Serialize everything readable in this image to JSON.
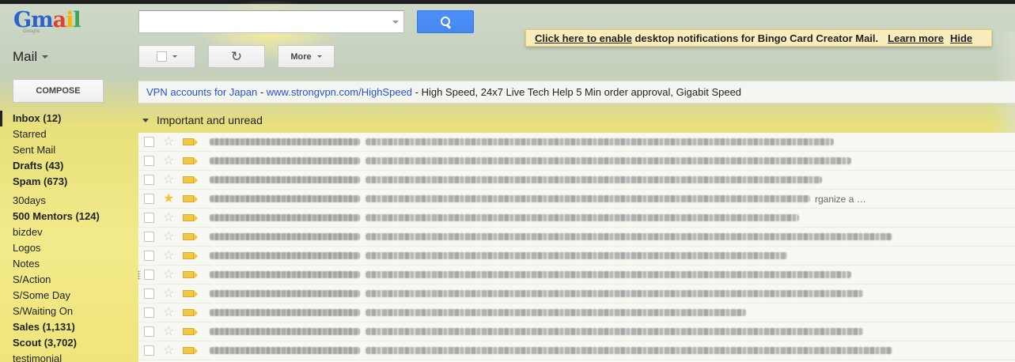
{
  "app": {
    "logo_text": [
      "G",
      "m",
      "a",
      "i",
      "l"
    ],
    "logo_sub": "Google",
    "mail_label": "Mail"
  },
  "search": {
    "value": "",
    "placeholder": ""
  },
  "notification": {
    "enable_link": "Click here to enable",
    "text": "desktop notifications for Bingo Card Creator Mail.",
    "learn_more": "Learn more",
    "hide": "Hide"
  },
  "toolbar": {
    "more_label": "More",
    "refresh_icon": "↻"
  },
  "compose": {
    "label": "COMPOSE"
  },
  "nav": {
    "items": [
      {
        "label": "Inbox (12)",
        "bold": true,
        "active": true
      },
      {
        "label": "Starred"
      },
      {
        "label": "Sent Mail"
      },
      {
        "label": "Drafts (43)",
        "bold": true
      },
      {
        "label": "Spam (673)",
        "bold": true
      },
      {
        "label": "30days"
      },
      {
        "label": "500 Mentors (124)",
        "bold": true
      },
      {
        "label": "bizdev"
      },
      {
        "label": "Logos"
      },
      {
        "label": "Notes"
      },
      {
        "label": "S/Action"
      },
      {
        "label": "S/Some Day"
      },
      {
        "label": "S/Waiting On"
      },
      {
        "label": "Sales (1,131)",
        "bold": true
      },
      {
        "label": "Scout (3,702)",
        "bold": true
      },
      {
        "label": "testimonial"
      }
    ]
  },
  "ad": {
    "title": "VPN accounts for Japan",
    "separator": " - ",
    "url": "www.strongvpn.com/HighSpeed",
    "description": " - High Speed, 24x7 Live Tech Help 5 Min order approval, Gigabit Speed"
  },
  "section": {
    "title": "Important and unread"
  },
  "colors": {
    "accent_blue": "#4d90fe",
    "link_blue": "#2255cc",
    "star_on": "#f4c430",
    "important_marker": "#f0c94a",
    "notification_bg": "#f9edbe"
  },
  "messages": [
    {
      "starred": false,
      "subject_fraction": 0.8,
      "tail": ""
    },
    {
      "starred": false,
      "subject_fraction": 0.83,
      "tail": ""
    },
    {
      "starred": false,
      "subject_fraction": 0.78,
      "tail": ""
    },
    {
      "starred": true,
      "subject_fraction": 0.76,
      "tail": "rganize a …"
    },
    {
      "starred": false,
      "subject_fraction": 0.74,
      "tail": ""
    },
    {
      "starred": false,
      "subject_fraction": 0.9,
      "tail": ""
    },
    {
      "starred": false,
      "subject_fraction": 0.72,
      "tail": ""
    },
    {
      "starred": false,
      "subject_fraction": 0.83,
      "tail": "",
      "grip": true
    },
    {
      "starred": false,
      "subject_fraction": 0.85,
      "tail": ""
    },
    {
      "starred": false,
      "subject_fraction": 0.65,
      "tail": ""
    },
    {
      "starred": false,
      "subject_fraction": 0.85,
      "tail": ""
    },
    {
      "starred": false,
      "subject_fraction": 0.9,
      "tail": ""
    }
  ]
}
